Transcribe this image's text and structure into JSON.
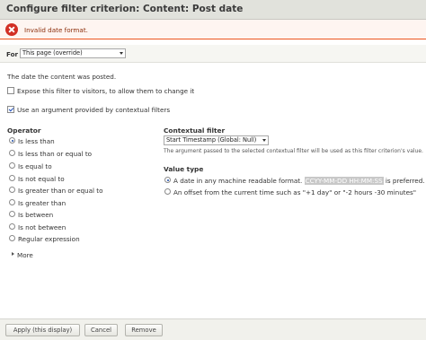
{
  "dialog": {
    "title": "Configure filter criterion: Content: Post date"
  },
  "error": {
    "message": "Invalid date format."
  },
  "for_bar": {
    "label": "For",
    "selected": "This page (override)"
  },
  "description": "The date the content was posted.",
  "expose_checkbox": {
    "label": "Expose this filter to visitors, to allow them to change it",
    "checked": false
  },
  "contextual_checkbox": {
    "label": "Use an argument provided by contextual filters",
    "checked": true
  },
  "operator": {
    "heading": "Operator",
    "selected_index": 0,
    "options": [
      "Is less than",
      "Is less than or equal to",
      "Is equal to",
      "Is not equal to",
      "Is greater than or equal to",
      "Is greater than",
      "Is between",
      "Is not between",
      "Regular expression"
    ]
  },
  "contextual_filter": {
    "heading": "Contextual filter",
    "selected": "Start Timestamp (Global: Null)",
    "help": "The argument passed to the selected contextual filter will be used as this filter criterion's value."
  },
  "value_type": {
    "heading": "Value type",
    "option1_prefix": "A date in any machine readable format.",
    "option1_code": "CCYY-MM-DD HH:MM:SS",
    "option1_suffix": "is preferred.",
    "option2": "An offset from the current time such as \"+1 day\" or \"-2 hours -30 minutes\"",
    "selected_index": 0
  },
  "more": {
    "label": "More"
  },
  "buttons": {
    "apply": "Apply (this display)",
    "cancel": "Cancel",
    "remove": "Remove"
  }
}
